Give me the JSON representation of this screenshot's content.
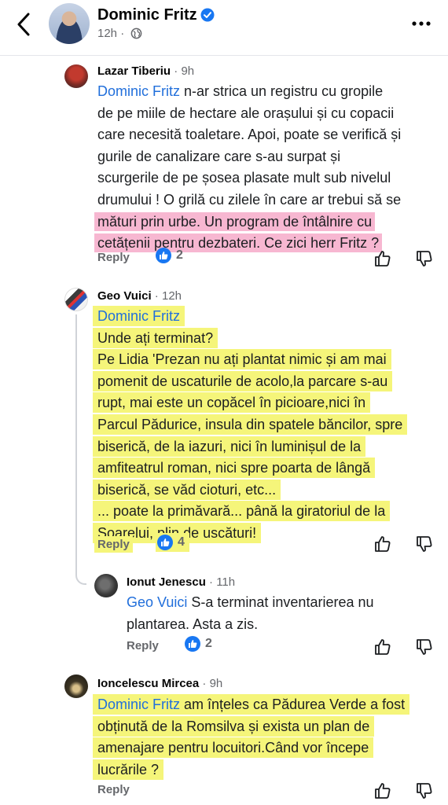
{
  "header": {
    "name": "Dominic Fritz",
    "time": "12h",
    "icons": {
      "back": "chevron-left-icon",
      "verified": "verified-badge-icon",
      "privacy": "globe-icon",
      "more": "more-dots-icon"
    }
  },
  "comments": [
    {
      "author": "Lazar Tiberiu",
      "time": "9h",
      "mention": "Dominic Fritz",
      "lines": [
        " n-ar strica un registru cu gropile",
        "de pe miile de hectare ale orașului și cu copacii",
        "care necesită toaletare. Apoi, poate se verifică și",
        "gurile de canalizare care s-au surpat și",
        "scurgerile de pe șosea plasate mult sub nivelul",
        "drumului ! O grilă cu zilele în care ar trebui să se",
        "mături prin urbe. Un program de întâlnire cu",
        "cetățenii pentru dezbateri. Ce zici herr Fritz ?"
      ],
      "reply_label": "Reply",
      "likes": "2"
    },
    {
      "author": "Geo Vuici",
      "time": "12h",
      "mention": "Dominic Fritz",
      "lines": [
        "Unde ați terminat?",
        "Pe Lidia 'Prezan nu ați plantat nimic și am mai",
        "pomenit de uscaturile de acolo,la parcare s-au",
        "rupt, mai este un copăcel în picioare,nici în",
        "Parcul Pădurice, insula din spatele băncilor, spre",
        "biserică, de la iazuri, nici în luminișul de la",
        "amfiteatrul roman, nici spre poarta de lângă",
        "biserică, se văd cioturi, etc...",
        "... poate la primăvară... până la giratoriul de la",
        "Soarelui, plin de uscături!"
      ],
      "reply_label": "Reply",
      "likes": "4"
    },
    {
      "author": "Ionut Jenescu",
      "time": "11h",
      "mention": "Geo Vuici",
      "lines": [
        " S-a terminat inventarierea nu",
        "plantarea. Asta a zis."
      ],
      "reply_label": "Reply",
      "likes": "2"
    },
    {
      "author": "Ioncelescu Mircea",
      "time": "9h",
      "mention": "Dominic Fritz",
      "lines": [
        " am înțeles ca Pădurea Verde a fost",
        "obținută de la Romsilva și exista un plan de",
        "amenajare pentru locuitori.Când vor începe",
        "lucrările ?"
      ],
      "reply_label": "Reply"
    }
  ],
  "colors": {
    "mention": "#216fdb",
    "pink_highlight": "#f7b7d1",
    "yellow_highlight": "#f5f57a",
    "like_blue": "#1877f2"
  }
}
